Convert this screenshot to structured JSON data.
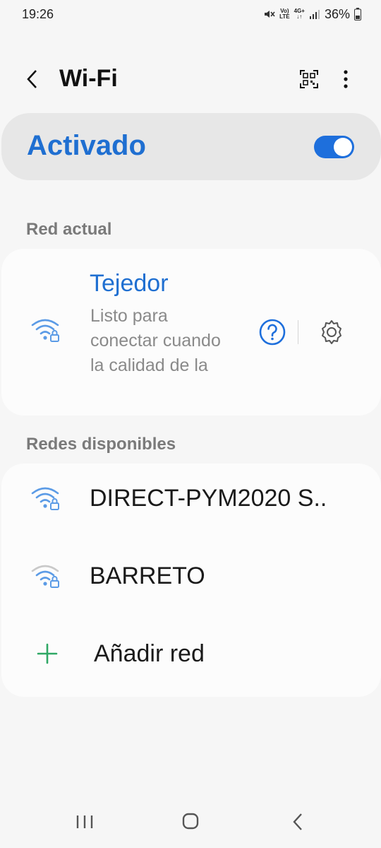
{
  "status_bar": {
    "time": "19:26",
    "volte_top": "Vo)",
    "volte_bottom": "LTE",
    "net_top": "4G+",
    "battery_percent": "36%",
    "icons": [
      "mute-icon",
      "signal-icon",
      "battery-icon"
    ]
  },
  "header": {
    "title": "Wi-Fi",
    "icons": [
      "back-icon",
      "qr-code-icon",
      "more-options-icon"
    ]
  },
  "master_switch": {
    "label": "Activado",
    "enabled": true,
    "accent_color": "#1e6fdc"
  },
  "current_network": {
    "section_title": "Red actual",
    "name": "Tejedor",
    "status": "Listo para conectar cuando la calidad de la",
    "icons": [
      "wifi-secured-icon",
      "help-icon",
      "settings-icon"
    ]
  },
  "available_networks": {
    "section_title": "Redes disponibles",
    "items": [
      {
        "name": "DIRECT-PYM2020 S..",
        "signal": "strong",
        "secured": true
      },
      {
        "name": "BARRETO",
        "signal": "weak",
        "secured": true
      }
    ],
    "add_label": "Añadir red",
    "add_icon_color": "#2fa865"
  },
  "nav_bar": {
    "icons": [
      "recent-apps-icon",
      "home-icon",
      "back-nav-icon"
    ]
  }
}
